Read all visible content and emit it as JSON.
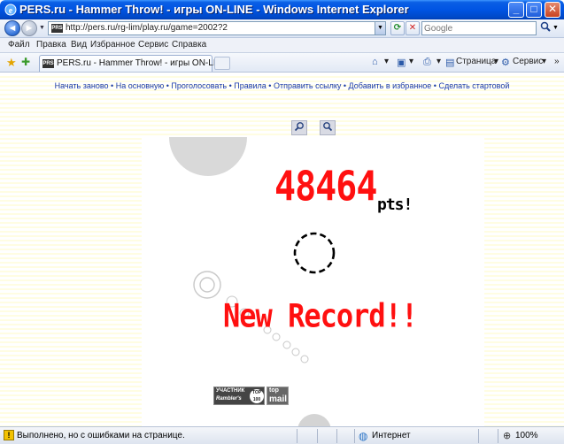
{
  "window": {
    "title": "PERS.ru - Hammer Throw! - игры ON-LINE - Windows Internet Explorer",
    "minimize": "_",
    "maximize": "□",
    "close": "✕"
  },
  "address": {
    "favicon": "PRS",
    "url": "http://pers.ru/rg-lim/play.ru/game=2002?2",
    "search_placeholder": "Google"
  },
  "menu": {
    "items": [
      "Файл",
      "Правка",
      "Вид",
      "Избранное",
      "Сервис",
      "Справка"
    ]
  },
  "tab": {
    "favicon": "PRS",
    "label": "PERS.ru - Hammer Throw! - игры ON-LINE"
  },
  "toolbar": {
    "page_label": "Страница",
    "tools_label": "Сервис"
  },
  "content": {
    "nav_links": [
      "Начать заново",
      "На основную",
      "Проголосовать",
      "Правила",
      "Отправить ссылку",
      "Добавить в избранное",
      "Сделать стартовой"
    ],
    "separator": "•",
    "game": {
      "score": "48464",
      "score_unit": "pts!",
      "message": "New Record!!"
    },
    "badges": {
      "rambler_top": "УЧАСТНИК",
      "rambler_name": "Rambler's",
      "rambler_top100": "TOP 100",
      "mail_top": "top",
      "mail_name": "mail"
    }
  },
  "status": {
    "text": "Выполнено, но с ошибками на странице.",
    "zone": "Интернет",
    "zoom": "100%"
  },
  "icons": {
    "back": "back-arrow-icon",
    "forward": "forward-arrow-icon",
    "refresh": "refresh-icon",
    "stop": "stop-icon",
    "search": "magnifier-icon",
    "favorites": "star-icon",
    "add_favorites": "add-favorite-icon",
    "zoom_in": "zoom-in-icon",
    "zoom_out": "zoom-out-icon",
    "warning": "warning-icon",
    "zone": "globe-icon"
  }
}
